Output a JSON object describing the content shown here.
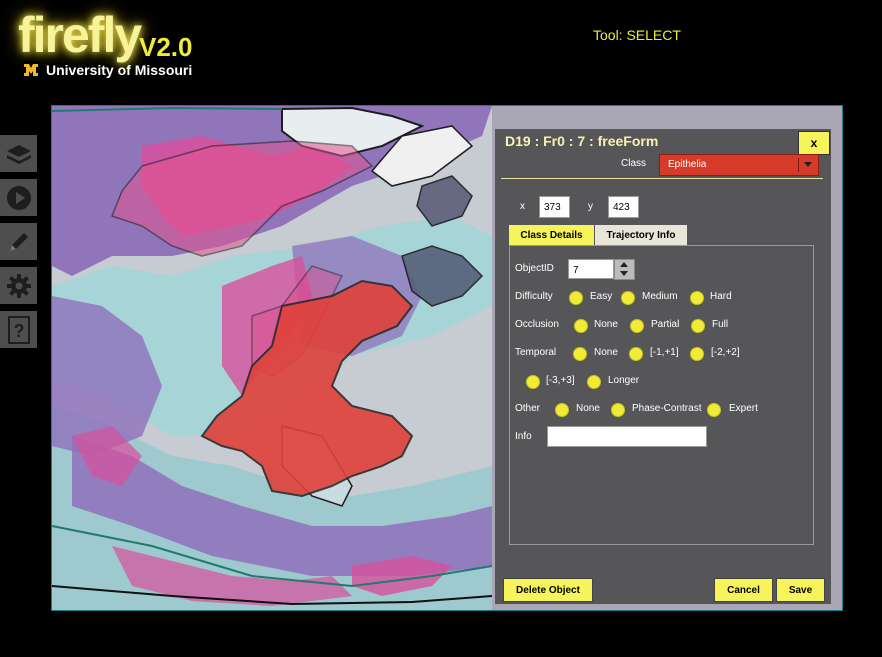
{
  "app": {
    "logo_word": "firefly",
    "logo_version": "V2.0",
    "university": "University of Missouri",
    "tool_status": "Tool: SELECT"
  },
  "toolbar": {
    "items": [
      {
        "name": "layers-icon"
      },
      {
        "name": "play-icon"
      },
      {
        "name": "pencil-icon"
      },
      {
        "name": "gear-icon"
      },
      {
        "name": "help-icon"
      }
    ]
  },
  "panel": {
    "title": "D19 : Fr0 : 7 : freeForm",
    "close_label": "x",
    "class_label": "Class",
    "class_value": "Epithelia",
    "x_label": "x",
    "x_value": "373",
    "y_label": "y",
    "y_value": "423",
    "tabs": [
      "Class Details",
      "Trajectory Info"
    ],
    "object_id_label": "ObjectID",
    "object_id_value": "7",
    "difficulty": {
      "label": "Difficulty",
      "options": [
        "Easy",
        "Medium",
        "Hard"
      ]
    },
    "occlusion": {
      "label": "Occlusion",
      "options": [
        "None",
        "Partial",
        "Full"
      ]
    },
    "temporal": {
      "label": "Temporal",
      "options": [
        "None",
        "[-1,+1]",
        "[-2,+2]",
        "[-3,+3]",
        "Longer"
      ]
    },
    "other": {
      "label": "Other",
      "options": [
        "None",
        "Phase-Contrast",
        "Expert"
      ]
    },
    "info_label": "Info",
    "info_value": "",
    "delete_label": "Delete Object",
    "cancel_label": "Cancel",
    "save_label": "Save"
  },
  "colors": {
    "accent_yellow": "#f7f35a",
    "class_red": "#d63a28",
    "highlight_red": "#e0413a",
    "panel_bg": "#484848"
  }
}
